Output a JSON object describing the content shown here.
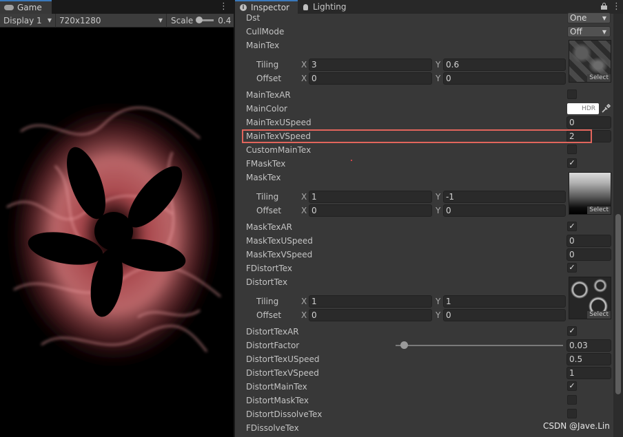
{
  "game": {
    "tab_label": "Game",
    "tab_icon": "gamepad-icon",
    "menu_icon": "kebab-menu-icon",
    "display": "Display 1",
    "resolution": "720x1280",
    "scale_label": "Scale",
    "scale_value": "0.4"
  },
  "inspector": {
    "tab_inspector": "Inspector",
    "tab_lighting": "Lighting",
    "tab_inspector_icon": "info-icon",
    "tab_lighting_icon": "lightbulb-icon",
    "lock_icon": "lock-icon",
    "accent_color": "#3a79bb",
    "highlight_color": "#e2655c",
    "properties": {
      "dst": {
        "label": "Dst",
        "value": "One"
      },
      "cullmode": {
        "label": "CullMode",
        "value": "Off"
      },
      "maintex": {
        "label": "MainTex",
        "tiling_label": "Tiling",
        "offset_label": "Offset",
        "tiling_x": "3",
        "tiling_y": "0.6",
        "offset_x": "0",
        "offset_y": "0",
        "select": "Select"
      },
      "maintexar": {
        "label": "MainTexAR",
        "checked": false
      },
      "maincolor": {
        "label": "MainColor",
        "hdr": "HDR"
      },
      "maintexuspeed": {
        "label": "MainTexUSpeed",
        "value": "0"
      },
      "maintexvspeed": {
        "label": "MainTexVSpeed",
        "value": "2"
      },
      "custommaintex": {
        "label": "CustomMainTex",
        "checked": false
      },
      "fmasktex": {
        "label": "FMaskTex",
        "checked": true
      },
      "masktex": {
        "label": "MaskTex",
        "tiling_label": "Tiling",
        "offset_label": "Offset",
        "tiling_x": "1",
        "tiling_y": "-1",
        "offset_x": "0",
        "offset_y": "0",
        "select": "Select"
      },
      "masktexar": {
        "label": "MaskTexAR",
        "checked": true
      },
      "masktexuspeed": {
        "label": "MaskTexUSpeed",
        "value": "0"
      },
      "masktexvspeed": {
        "label": "MaskTexVSpeed",
        "value": "0"
      },
      "fdistorttex": {
        "label": "FDistortTex",
        "checked": true
      },
      "distorttex": {
        "label": "DistortTex",
        "tiling_label": "Tiling",
        "offset_label": "Offset",
        "tiling_x": "1",
        "tiling_y": "1",
        "offset_x": "0",
        "offset_y": "0",
        "select": "Select"
      },
      "distorttexar": {
        "label": "DistortTexAR",
        "checked": true
      },
      "distortfactor": {
        "label": "DistortFactor",
        "value": "0.03"
      },
      "distorttexuspeed": {
        "label": "DistortTexUSpeed",
        "value": "0.5"
      },
      "distorttexvspeed": {
        "label": "DistortTexVSpeed",
        "value": "1"
      },
      "distortmaintex": {
        "label": "DistortMainTex",
        "checked": true
      },
      "distortmasktex": {
        "label": "DistortMaskTex",
        "checked": false
      },
      "distortdissolvetex": {
        "label": "DistortDissolveTex",
        "checked": false
      },
      "fdissolvetex": {
        "label": "FDissolveTex"
      }
    },
    "axis_x": "X",
    "axis_y": "Y"
  },
  "watermark": "CSDN @Jave.Lin"
}
